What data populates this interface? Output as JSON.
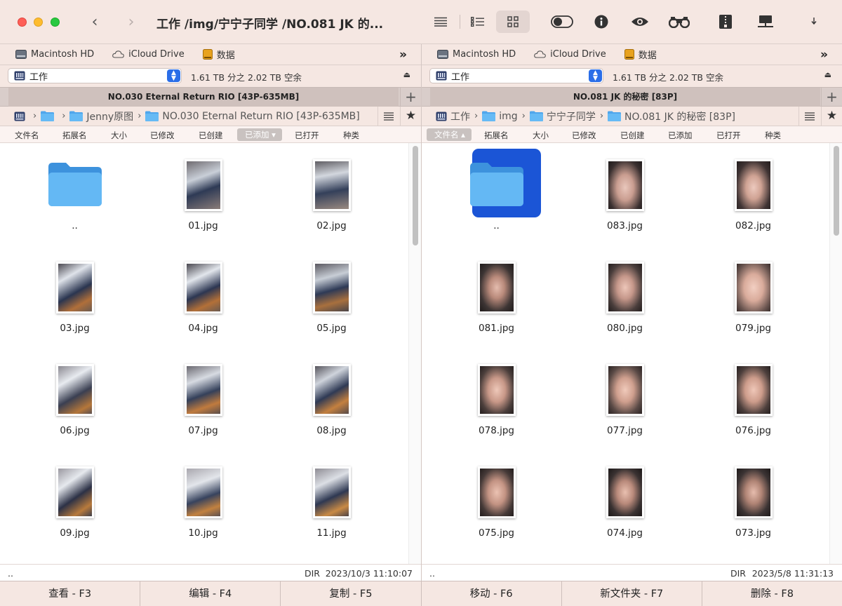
{
  "window": {
    "title": "工作 /img/宁宁子同学 /NO.081 JK 的..."
  },
  "volumes": [
    "Macintosh HD",
    "iCloud Drive",
    "数据"
  ],
  "columns": [
    "文件名",
    "拓展名",
    "大小",
    "已修改",
    "已创建",
    "已添加",
    "已打开",
    "种类"
  ],
  "left": {
    "drive": "工作",
    "free_space": "1.61 TB 分之 2.02 TB 空余",
    "tab": "NO.030 Eternal Return RIO [43P-635MB]",
    "path": [
      "",
      "Jenny原图",
      "NO.030 Eternal Return RIO [43P-635MB]"
    ],
    "sorted_column": "已添加",
    "status": {
      "name": "..",
      "kind": "DIR",
      "date": "2023/10/3 11:10:07"
    },
    "files": [
      "..",
      "01.jpg",
      "02.jpg",
      "03.jpg",
      "04.jpg",
      "05.jpg",
      "06.jpg",
      "07.jpg",
      "08.jpg",
      "09.jpg",
      "10.jpg",
      "11.jpg"
    ]
  },
  "right": {
    "drive": "工作",
    "free_space": "1.61 TB 分之 2.02 TB 空余",
    "tab": "NO.081 JK 的秘密 [83P]",
    "path": [
      "工作",
      "img",
      "宁宁子同学",
      "NO.081 JK 的秘密 [83P]"
    ],
    "sorted_column": "文件名",
    "status": {
      "name": "..",
      "kind": "DIR",
      "date": "2023/5/8 11:31:13"
    },
    "files": [
      "..",
      "083.jpg",
      "082.jpg",
      "081.jpg",
      "080.jpg",
      "079.jpg",
      "078.jpg",
      "077.jpg",
      "076.jpg",
      "075.jpg",
      "074.jpg",
      "073.jpg"
    ]
  },
  "function_keys": [
    "查看 - F3",
    "编辑 - F4",
    "复制 - F5",
    "移动 - F6",
    "新文件夹 - F7",
    "删除 - F8"
  ],
  "colors": {
    "chrome": "#f5e7e2",
    "selection": "#1b55d6",
    "folder": "#5eb3f2"
  }
}
